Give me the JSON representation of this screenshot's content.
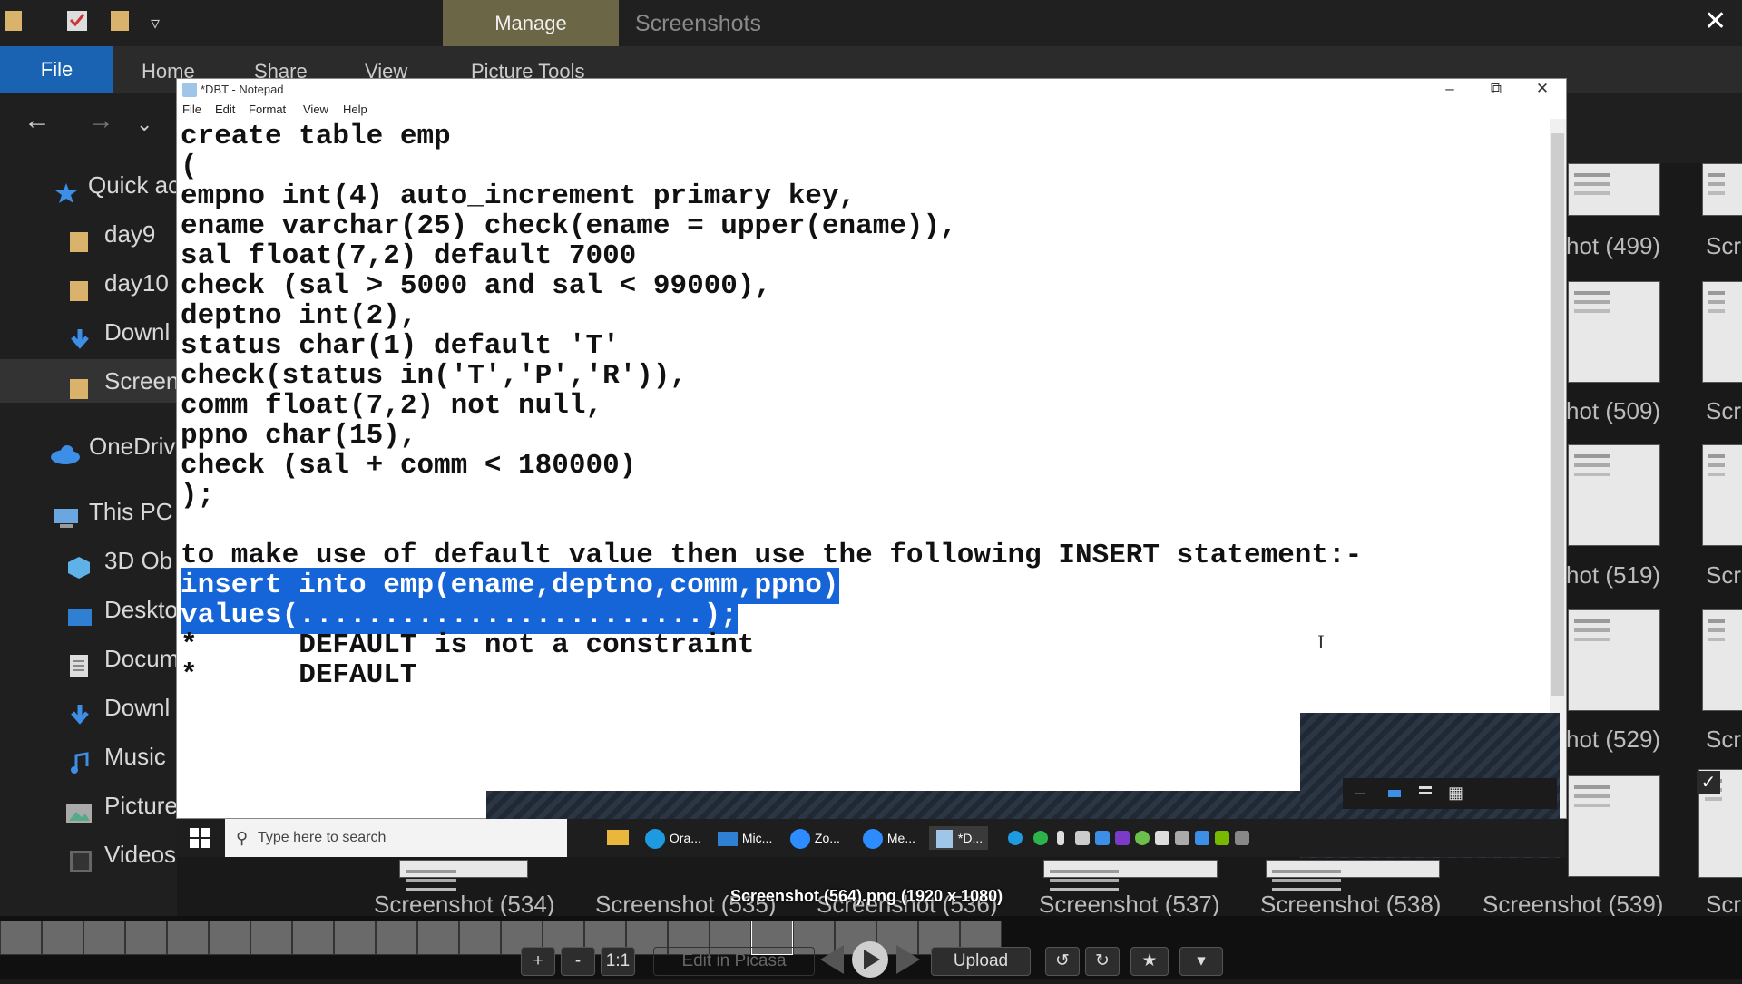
{
  "explorer": {
    "manage_tab": "Manage",
    "window_title": "Screenshots",
    "ribbon": {
      "file": "File",
      "home": "Home",
      "share": "Share",
      "view": "View",
      "picture_tools": "Picture Tools"
    },
    "sidebar": [
      {
        "label": "Quick ac",
        "icon": "star-icon"
      },
      {
        "label": "day9",
        "icon": "folder-icon"
      },
      {
        "label": "day10",
        "icon": "folder-icon"
      },
      {
        "label": "Downl",
        "icon": "download-icon"
      },
      {
        "label": "Screen",
        "icon": "folder-icon"
      },
      {
        "label": "OneDriv",
        "icon": "cloud-icon"
      },
      {
        "label": "This PC",
        "icon": "computer-icon"
      },
      {
        "label": "3D Ob",
        "icon": "cube-icon"
      },
      {
        "label": "Deskto",
        "icon": "desktop-icon"
      },
      {
        "label": "Docum",
        "icon": "document-icon"
      },
      {
        "label": "Downl",
        "icon": "download-icon"
      },
      {
        "label": "Music",
        "icon": "music-icon"
      },
      {
        "label": "Picture",
        "icon": "picture-icon"
      },
      {
        "label": "Videos",
        "icon": "video-icon"
      }
    ],
    "thumb_labels_right": [
      "hot (499)",
      "Scre",
      "hot (509)",
      "Scre",
      "hot (519)",
      "Scre",
      "hot (529)",
      "Scre"
    ],
    "thumb_labels_bottom": [
      "Screenshot (534)",
      "Screenshot (535)",
      "Screenshot (536)",
      "Screenshot (537)",
      "Screenshot (538)",
      "Screenshot (539)",
      "Scre"
    ]
  },
  "viewer": {
    "caption": "Screenshot (564).png (1920 x 1080)",
    "controls": {
      "plus": "+",
      "minus": "-",
      "one_to_one": "1:1",
      "edit": "Edit in Picasa",
      "upload": "Upload"
    }
  },
  "notepad": {
    "title": "*DBT - Notepad",
    "menu": [
      "File",
      "Edit",
      "Format",
      "View",
      "Help"
    ],
    "lines": [
      "create table emp",
      "(",
      "empno int(4) auto_increment primary key,",
      "ename varchar(25) check(ename = upper(ename)),",
      "sal float(7,2) default 7000",
      "check (sal > 5000 and sal < 99000),",
      "deptno int(2),",
      "status char(1) default 'T'",
      "check(status in('T','P','R')),",
      "comm float(7,2) not null,",
      "ppno char(15),",
      "check (sal + comm < 180000)",
      ");",
      "",
      "to make use of default value then use the following INSERT statement:-",
      "insert into emp(ename,deptno,comm,ppno)",
      "values(........................);",
      "*      DEFAULT is not a constraint",
      "*      DEFAULT"
    ]
  },
  "taskbar": {
    "search_placeholder": "Type here to search",
    "apps": [
      "Ora...",
      "Mic...",
      "Zo...",
      "Me...",
      "*D..."
    ]
  }
}
